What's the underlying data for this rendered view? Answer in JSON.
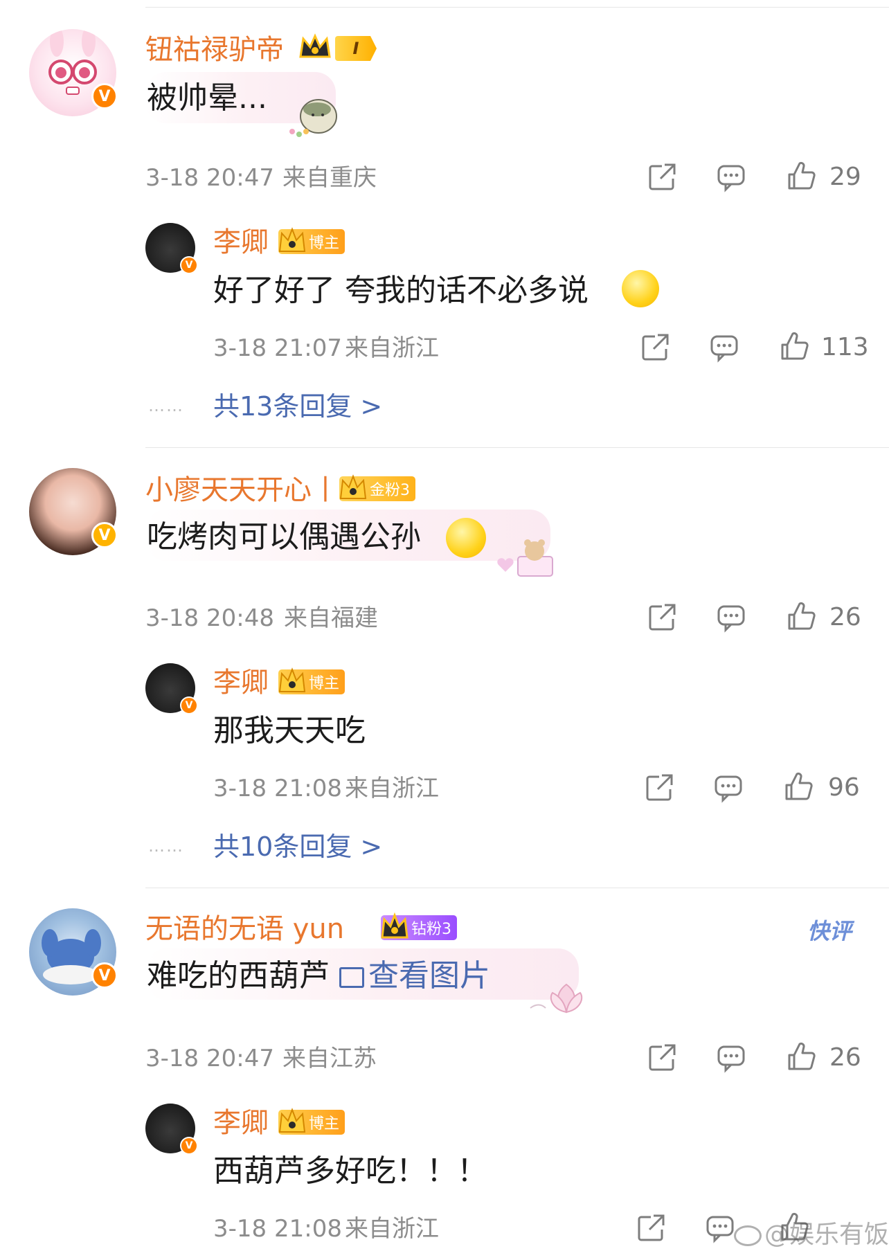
{
  "comments": [
    {
      "username": "钮祜禄驴帝",
      "level_badge": "I",
      "text": "被帅晕...",
      "time": "3-18 20:47",
      "location": "来自重庆",
      "likes": "29",
      "reply": {
        "username": "李卿",
        "badge": "博主",
        "text": "好了好了 夸我的话不必多说",
        "time": "3-18 21:07",
        "location": "来自浙江",
        "likes": "113"
      },
      "more_replies": "共13条回复 >"
    },
    {
      "username": "小廖天天开心丨",
      "badge": "金粉3",
      "text": "吃烤肉可以偶遇公孙",
      "time": "3-18 20:48",
      "location": "来自福建",
      "likes": "26",
      "reply": {
        "username": "李卿",
        "badge": "博主",
        "text": "那我天天吃",
        "time": "3-18 21:08",
        "location": "来自浙江",
        "likes": "96"
      },
      "more_replies": "共10条回复 >"
    },
    {
      "username": "无语的无语 yun",
      "badge": "钻粉3",
      "tag": "快评",
      "text": "难吃的西葫芦",
      "link_text": "查看图片",
      "time": "3-18 20:47",
      "location": "来自江苏",
      "likes": "26",
      "reply": {
        "username": "李卿",
        "badge": "博主",
        "text": "西葫芦多好吃！！！",
        "time": "3-18 21:08",
        "location": "来自浙江",
        "likes": ""
      }
    }
  ],
  "watermark": "@娱乐有饭",
  "more_dots": "……",
  "colors": {
    "username": "#e8772e",
    "link": "#4a6ab0",
    "meta": "#8c8c8c",
    "verified": "#ff8200"
  },
  "icons": [
    "share-icon",
    "comment-icon",
    "like-icon",
    "picture-icon",
    "crown-icon",
    "verified-icon"
  ]
}
